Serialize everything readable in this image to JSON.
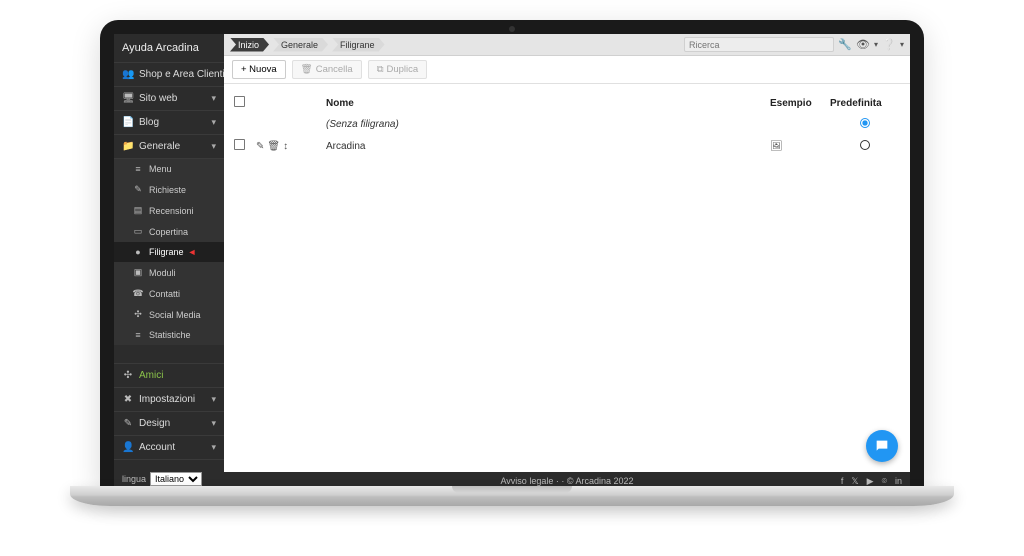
{
  "app_title": "Ayuda Arcadina",
  "sidebar": {
    "items": [
      {
        "icon": "👥",
        "label": "Shop e Area Clienti"
      },
      {
        "icon": "🖥",
        "label": "Sito web"
      },
      {
        "icon": "📄",
        "label": "Blog"
      },
      {
        "icon": "📁",
        "label": "Generale"
      }
    ],
    "sub_items": [
      {
        "icon": "≡",
        "label": "Menu"
      },
      {
        "icon": "✎",
        "label": "Richieste"
      },
      {
        "icon": "▤",
        "label": "Recensioni"
      },
      {
        "icon": "▭",
        "label": "Copertina"
      },
      {
        "icon": "●",
        "label": "Filigrane",
        "active": true,
        "arrow": "◄"
      },
      {
        "icon": "▣",
        "label": "Moduli"
      },
      {
        "icon": "☎",
        "label": "Contatti"
      },
      {
        "icon": "✣",
        "label": "Social Media"
      },
      {
        "icon": "≡",
        "label": "Statistiche"
      }
    ],
    "lower_items": [
      {
        "icon": "✣",
        "label": "Amici",
        "class": "amici"
      },
      {
        "icon": "✖",
        "label": "Impostazioni"
      },
      {
        "icon": "✎",
        "label": "Design"
      },
      {
        "icon": "👤",
        "label": "Account"
      }
    ],
    "lang_label": "lingua",
    "lang_value": "Italiano"
  },
  "breadcrumbs": [
    "Inizio",
    "Generale",
    "Filigrane"
  ],
  "search_placeholder": "Ricerca",
  "toolbar": {
    "new": "+ Nuova",
    "delete": "Cancella",
    "duplicate": "Duplica"
  },
  "table": {
    "headers": {
      "name": "Nome",
      "example": "Esempio",
      "default": "Predefinita"
    },
    "rows": [
      {
        "name": "(Senza filigrana)",
        "example": "",
        "default": true,
        "editable": false
      },
      {
        "name": "Arcadina",
        "example": "img",
        "default": false,
        "editable": true
      }
    ]
  },
  "footer": {
    "text": "Avviso legale ·  · © Arcadina 2022",
    "socials": [
      "f",
      "𝕏",
      "▶",
      "⌾",
      "in"
    ]
  }
}
